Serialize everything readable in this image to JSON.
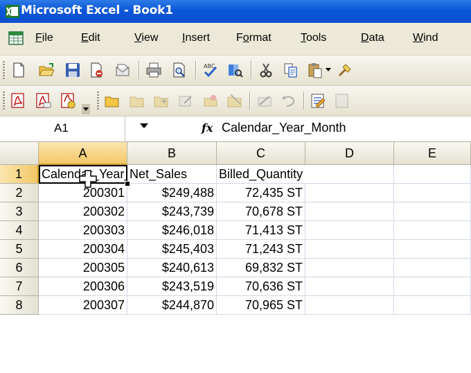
{
  "window": {
    "title": "Microsoft Excel - Book1"
  },
  "menu": {
    "items": [
      {
        "label": "File",
        "acc": "F",
        "rest": "ile"
      },
      {
        "label": "Edit",
        "acc": "E",
        "rest": "dit"
      },
      {
        "label": "View",
        "acc": "V",
        "rest": "iew"
      },
      {
        "label": "Insert",
        "acc": "I",
        "rest": "nsert"
      },
      {
        "label": "Format",
        "pre": "F",
        "acc": "o",
        "rest": "rmat"
      },
      {
        "label": "Tools",
        "acc": "T",
        "rest": "ools"
      },
      {
        "label": "Data",
        "acc": "D",
        "rest": "ata"
      },
      {
        "label": "Wind",
        "acc": "W",
        "rest": "ind"
      }
    ]
  },
  "formula_bar": {
    "name_box": "A1",
    "fx": "fx",
    "formula": "Calendar_Year_Month"
  },
  "grid": {
    "columns": [
      "A",
      "B",
      "C",
      "D",
      "E"
    ],
    "rows": [
      {
        "row": "1",
        "a": "Calendar_Year_Month",
        "b": "Net_Sales",
        "c": "Billed_Quantity"
      },
      {
        "row": "2",
        "a": "200301",
        "b": "$249,488",
        "c": "72,435 ST"
      },
      {
        "row": "3",
        "a": "200302",
        "b": "$243,739",
        "c": "70,678 ST"
      },
      {
        "row": "4",
        "a": "200303",
        "b": "$246,018",
        "c": "71,413 ST"
      },
      {
        "row": "5",
        "a": "200304",
        "b": "$245,403",
        "c": "71,243 ST"
      },
      {
        "row": "6",
        "a": "200305",
        "b": "$240,613",
        "c": "69,832 ST"
      },
      {
        "row": "7",
        "a": "200306",
        "b": "$243,519",
        "c": "70,636 ST"
      },
      {
        "row": "8",
        "a": "200307",
        "b": "$244,870",
        "c": "70,965 ST"
      }
    ]
  },
  "colors": {
    "title_bar": "#0a56d8",
    "chrome": "#ece9d8",
    "selection_header": "#f3c766"
  }
}
